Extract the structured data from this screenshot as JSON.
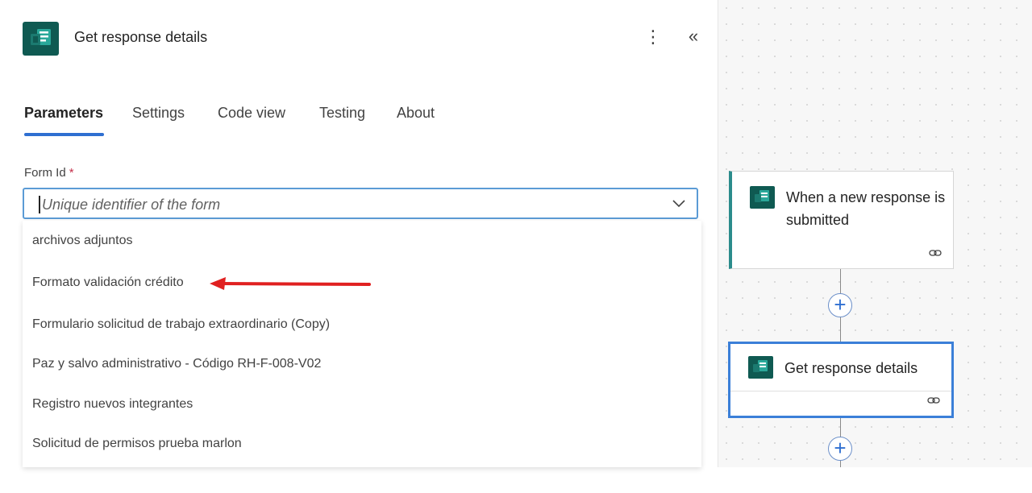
{
  "panel": {
    "title": "Get response details",
    "more_label": "⋮",
    "collapse_label": "«"
  },
  "tabs": [
    {
      "label": "Parameters",
      "active": true
    },
    {
      "label": "Settings",
      "active": false
    },
    {
      "label": "Code view",
      "active": false
    },
    {
      "label": "Testing",
      "active": false
    },
    {
      "label": "About",
      "active": false
    }
  ],
  "form_id": {
    "label": "Form Id",
    "required_mark": "*",
    "placeholder": "Unique identifier of the form"
  },
  "dropdown": {
    "options": [
      "archivos adjuntos",
      "Formato validación crédito",
      "Formulario solicitud de trabajo extraordinario (Copy)",
      "Paz y salvo administrativo - Código RH-F-008-V02",
      "Registro nuevos integrantes",
      "Solicitud de permisos prueba marlon"
    ]
  },
  "annotation": {
    "color": "#e02020",
    "points_to": "Formato validación crédito"
  },
  "canvas": {
    "trigger_node": {
      "title": "When a new response is submitted",
      "icon": "forms-icon",
      "link_icon": "link-icon"
    },
    "action_node": {
      "title": "Get response details",
      "icon": "forms-icon",
      "link_icon": "link-icon"
    },
    "add_label": "+"
  },
  "colors": {
    "accent": "#2f6fd1",
    "forms_green": "#0f5a52",
    "required": "#c4314b",
    "selected_node_border": "#3b7fd8"
  }
}
